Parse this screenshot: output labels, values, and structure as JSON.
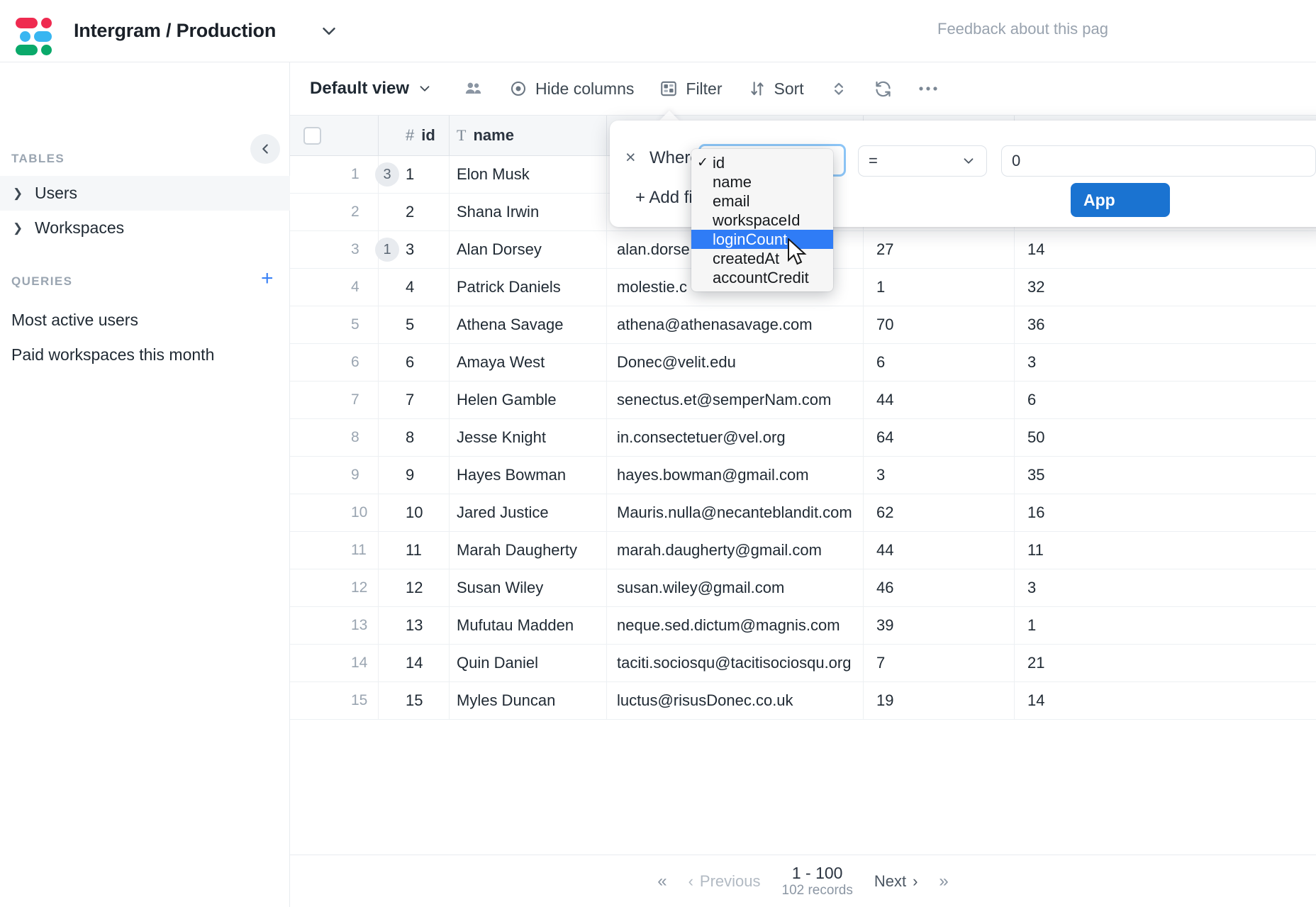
{
  "header": {
    "project_title": "Intergram / Production",
    "caret_icon": "chevron-down-icon",
    "feedback_link": "Feedback about this pag"
  },
  "sidebar": {
    "tables_label": "TABLES",
    "queries_label": "QUERIES",
    "add_query_icon": "plus-icon",
    "collapse_icon": "chevron-left-icon",
    "tables": [
      {
        "label": "Users",
        "expand_icon": "chevron-right-icon",
        "selected": true
      },
      {
        "label": "Workspaces",
        "expand_icon": "chevron-right-icon",
        "selected": false
      }
    ],
    "queries": [
      {
        "label": "Most active users"
      },
      {
        "label": "Paid workspaces this month"
      }
    ]
  },
  "toolbar": {
    "view_name": "Default view",
    "view_caret_icon": "chevron-down-icon",
    "share_icon": "people-icon",
    "hide_columns_label": "Hide columns",
    "hide_columns_icon": "eye-icon",
    "filter_label": "Filter",
    "filter_icon": "filter-icon",
    "sort_label": "Sort",
    "sort_icon": "sort-arrows-icon",
    "row_height_icon": "row-height-icon",
    "refresh_icon": "refresh-icon",
    "more_icon": "ellipsis-icon"
  },
  "filter_popup": {
    "close_icon": "close-icon",
    "where_label": "Where",
    "add_filter_label": "+ Add fi",
    "field_value": "",
    "operator_value": "=",
    "operator_caret_icon": "chevron-down-icon",
    "value_input": "0",
    "apply_label": "App",
    "accent_color": "#1a73d1",
    "field_options": [
      {
        "label": "id",
        "checked": true,
        "highlighted": false
      },
      {
        "label": "name",
        "checked": false,
        "highlighted": false
      },
      {
        "label": "email",
        "checked": false,
        "highlighted": false
      },
      {
        "label": "workspaceId",
        "checked": false,
        "highlighted": false
      },
      {
        "label": "loginCount",
        "checked": false,
        "highlighted": true
      },
      {
        "label": "createdAt",
        "checked": false,
        "highlighted": false
      },
      {
        "label": "accountCredit",
        "checked": false,
        "highlighted": false
      }
    ]
  },
  "table": {
    "columns": [
      {
        "label": "id",
        "type_icon": "#"
      },
      {
        "label": "name",
        "type_icon": "T"
      }
    ],
    "select_all_icon": "checkbox-icon",
    "rows": [
      {
        "n": "1",
        "badge": "3",
        "id": "1",
        "name": "Elon Musk",
        "email": "",
        "loginCount": "",
        "accountCredit": ""
      },
      {
        "n": "2",
        "badge": "",
        "id": "2",
        "name": "Shana Irwin",
        "email": "",
        "loginCount": "",
        "accountCredit": ""
      },
      {
        "n": "3",
        "badge": "1",
        "id": "3",
        "name": "Alan Dorsey",
        "email": "alan.dorse",
        "loginCount": "27",
        "accountCredit": "14"
      },
      {
        "n": "4",
        "badge": "",
        "id": "4",
        "name": "Patrick Daniels",
        "email": "molestie.c",
        "loginCount": "1",
        "accountCredit": "32"
      },
      {
        "n": "5",
        "badge": "",
        "id": "5",
        "name": "Athena Savage",
        "email": "athena@athenasavage.com",
        "loginCount": "70",
        "accountCredit": "36"
      },
      {
        "n": "6",
        "badge": "",
        "id": "6",
        "name": "Amaya West",
        "email": "Donec@velit.edu",
        "loginCount": "6",
        "accountCredit": "3"
      },
      {
        "n": "7",
        "badge": "",
        "id": "7",
        "name": "Helen Gamble",
        "email": "senectus.et@semperNam.com",
        "loginCount": "44",
        "accountCredit": "6"
      },
      {
        "n": "8",
        "badge": "",
        "id": "8",
        "name": "Jesse Knight",
        "email": "in.consectetuer@vel.org",
        "loginCount": "64",
        "accountCredit": "50"
      },
      {
        "n": "9",
        "badge": "",
        "id": "9",
        "name": "Hayes Bowman",
        "email": "hayes.bowman@gmail.com",
        "loginCount": "3",
        "accountCredit": "35"
      },
      {
        "n": "10",
        "badge": "",
        "id": "10",
        "name": "Jared Justice",
        "email": "Mauris.nulla@necanteblandit.com",
        "loginCount": "62",
        "accountCredit": "16"
      },
      {
        "n": "11",
        "badge": "",
        "id": "11",
        "name": "Marah Daugherty",
        "email": "marah.daugherty@gmail.com",
        "loginCount": "44",
        "accountCredit": "11"
      },
      {
        "n": "12",
        "badge": "",
        "id": "12",
        "name": "Susan Wiley",
        "email": "susan.wiley@gmail.com",
        "loginCount": "46",
        "accountCredit": "3"
      },
      {
        "n": "13",
        "badge": "",
        "id": "13",
        "name": "Mufutau Madden",
        "email": "neque.sed.dictum@magnis.com",
        "loginCount": "39",
        "accountCredit": "1"
      },
      {
        "n": "14",
        "badge": "",
        "id": "14",
        "name": "Quin Daniel",
        "email": "taciti.sociosqu@tacitisociosqu.org",
        "loginCount": "7",
        "accountCredit": "21"
      },
      {
        "n": "15",
        "badge": "",
        "id": "15",
        "name": "Myles Duncan",
        "email": "luctus@risusDonec.co.uk",
        "loginCount": "19",
        "accountCredit": "14"
      }
    ]
  },
  "pagination": {
    "first_icon": "«",
    "prev_label": "Previous",
    "prev_icon": "‹",
    "range_label": "1 - 100",
    "records_label": "102 records",
    "next_label": "Next",
    "next_icon": "›",
    "last_icon": "»"
  }
}
